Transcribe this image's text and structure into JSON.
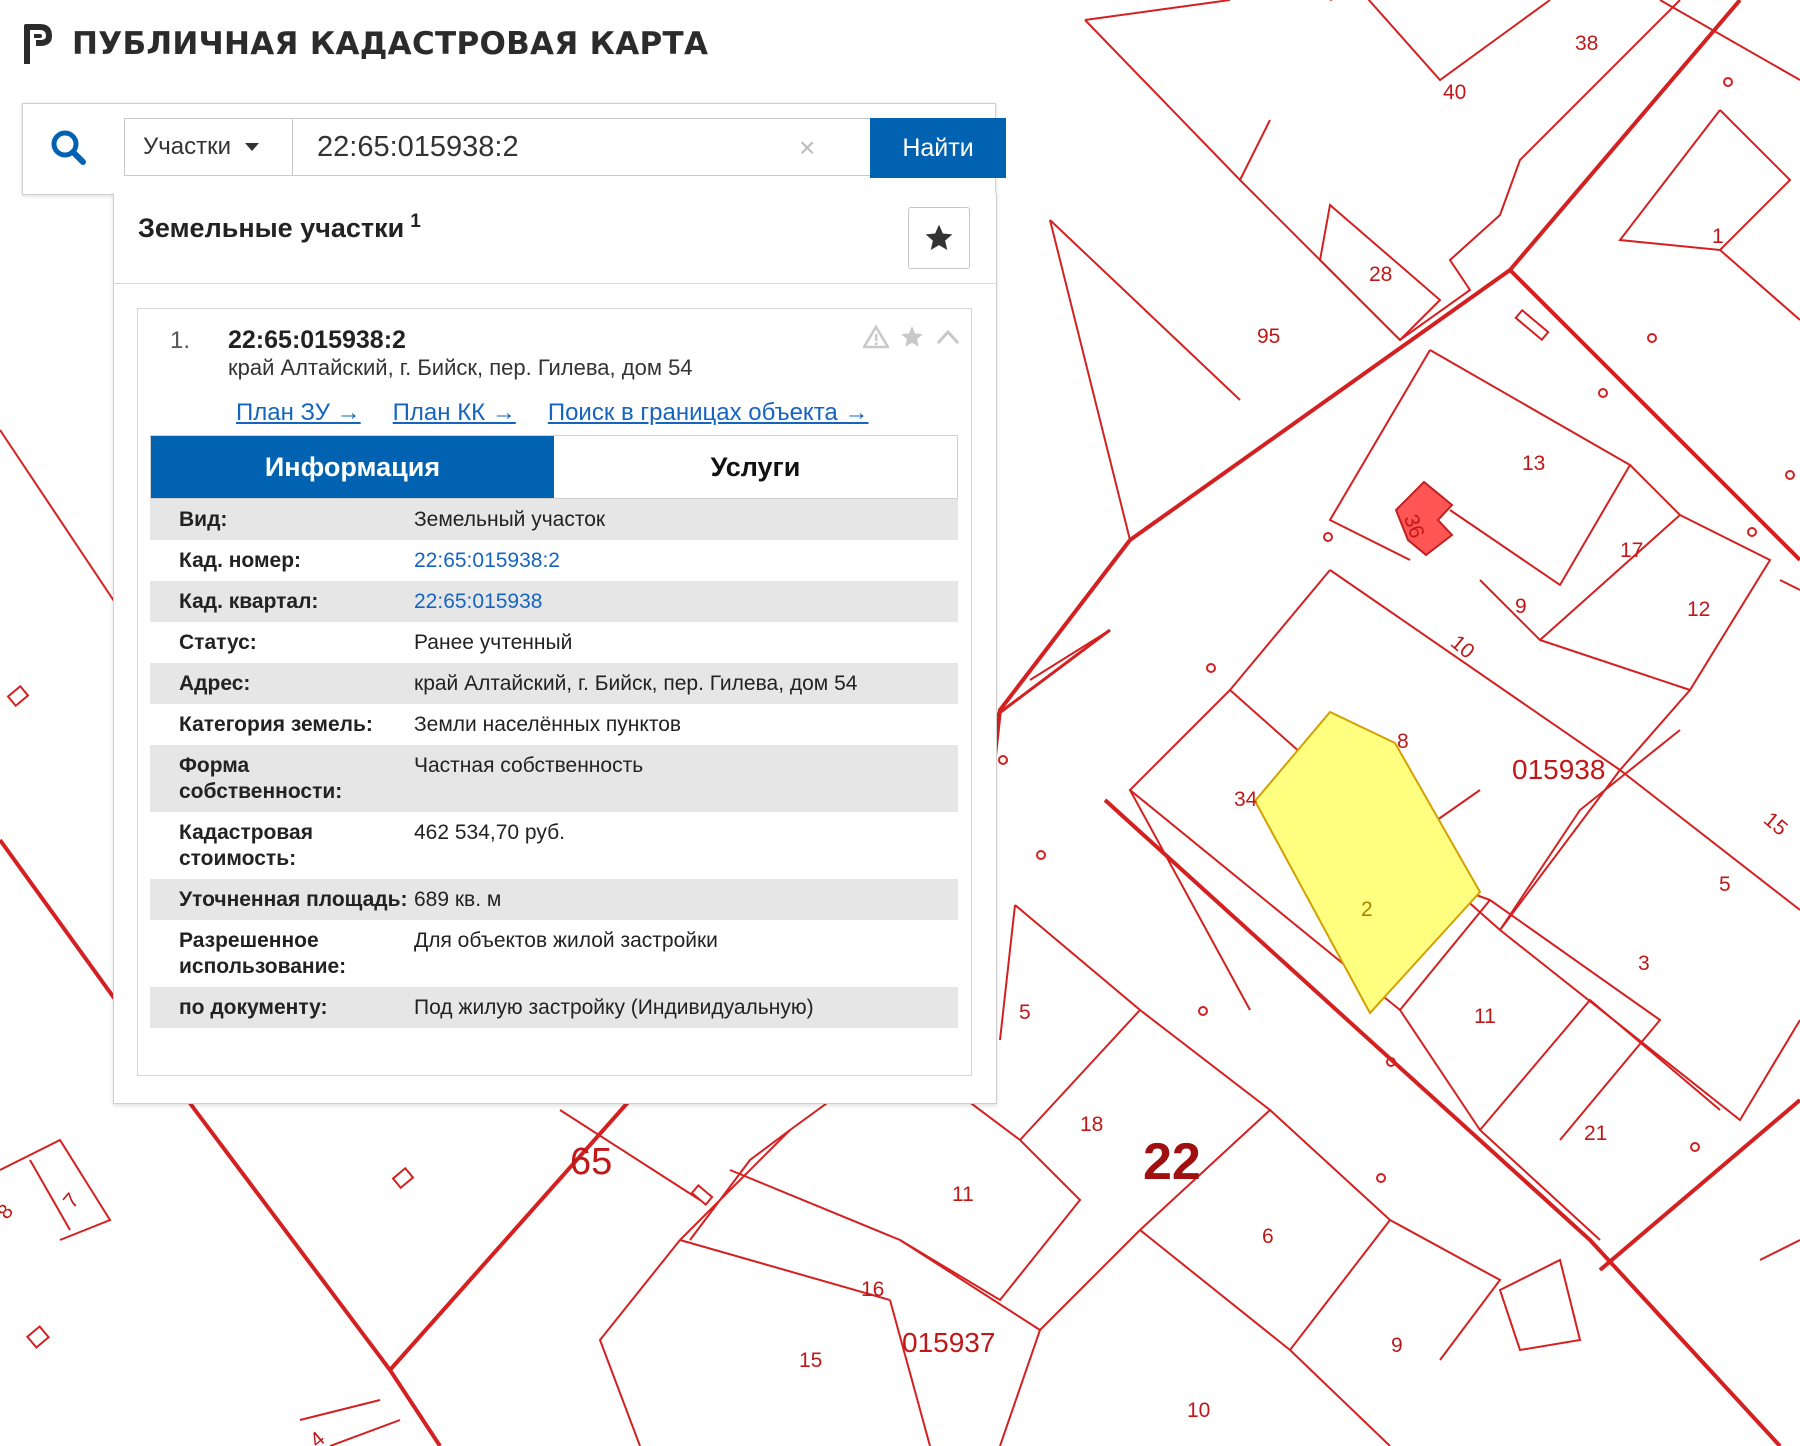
{
  "app": {
    "title": "ПУБЛИЧНАЯ КАДАСТРОВАЯ КАРТА"
  },
  "search": {
    "type_label": "Участки",
    "query": "22:65:015938:2",
    "clear_symbol": "×",
    "find_label": "Найти"
  },
  "panel": {
    "title": "Земельные участки",
    "count": "1"
  },
  "result": {
    "index": "1.",
    "cadastral_number": "22:65:015938:2",
    "address": "край Алтайский, г. Бийск, пер. Гилева, дом 54",
    "links": [
      "План ЗУ →",
      "План КК →",
      "Поиск в границах объекта →"
    ],
    "tabs": [
      "Информация",
      "Услуги"
    ],
    "active_tab": "Информация"
  },
  "info": {
    "rows": [
      {
        "key": "Вид:",
        "value": "Земельный участок"
      },
      {
        "key": "Кад. номер:",
        "value": "22:65:015938:2"
      },
      {
        "key": "Кад. квартал:",
        "value": "22:65:015938"
      },
      {
        "key": "Статус:",
        "value": "Ранее учтенный"
      },
      {
        "key": "Адрес:",
        "value": "край Алтайский, г. Бийск, пер. Гилева, дом 54"
      },
      {
        "key": "Категория земель:",
        "value": "Земли населённых пунктов"
      },
      {
        "key": "Форма собственности:",
        "value": "Частная собственность"
      },
      {
        "key": "Кадастровая стоимость:",
        "value": "462 534,70 руб."
      },
      {
        "key": "Уточненная площадь:",
        "value": "689 кв. м"
      },
      {
        "key": "Разрешенное использование:",
        "value": "Для объектов жилой застройки"
      },
      {
        "key": "по документу:",
        "value": "Под жилую застройку (Индивидуальную)"
      }
    ]
  },
  "map": {
    "colors": {
      "boundary": "#d42020",
      "highlight_fill": "#ffff80",
      "building_fill": "#ff5555"
    },
    "parcel_labels": [
      "38",
      "40",
      "1",
      "28",
      "95",
      "13",
      "36",
      "17",
      "9",
      "12",
      "10",
      "8",
      "015938",
      "34",
      "15",
      "5",
      "2",
      "3",
      "11",
      "21",
      "5",
      "18",
      "22",
      "11",
      "65",
      "16",
      "6",
      "015937",
      "15",
      "9",
      "10",
      "7",
      "8",
      "4"
    ]
  }
}
